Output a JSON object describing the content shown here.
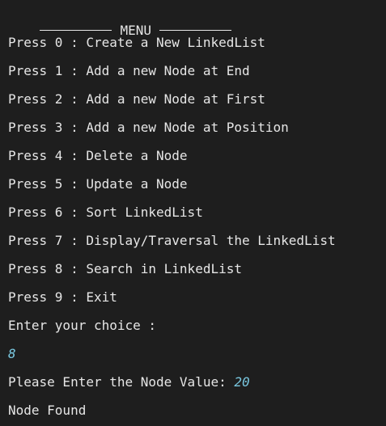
{
  "menu": {
    "title": "MENU",
    "options": [
      "Press 0 : Create a New LinkedList",
      "Press 1 : Add a new Node at End",
      "Press 2 : Add a new Node at First",
      "Press 3 : Add a new Node at Position",
      "Press 4 : Delete a Node",
      "Press 5 : Update a Node",
      "Press 6 : Sort LinkedList",
      "Press 7 : Display/Traversal the LinkedList",
      "Press 8 : Search in LinkedList",
      "Press 9 : Exit"
    ]
  },
  "prompt": {
    "choice_label": "Enter your choice :",
    "choice_value": "8",
    "node_value_label": "Please Enter the Node Value: ",
    "node_value": "20"
  },
  "result": "Node Found",
  "colors": {
    "background": "#1e1e1e",
    "text": "#e6e6e6",
    "user_input": "#79c7df"
  }
}
